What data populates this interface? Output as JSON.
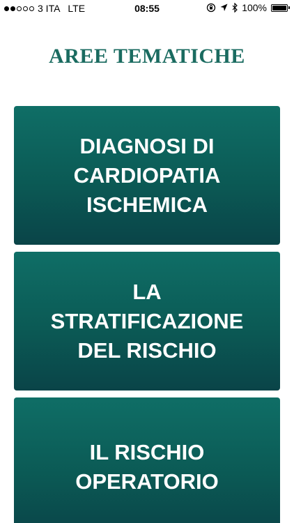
{
  "status_bar": {
    "carrier": "3 ITA",
    "network": "LTE",
    "time": "08:55",
    "battery": "100%",
    "battery_level": 1.0,
    "signal_bars_filled": 2,
    "signal_bars_total": 5
  },
  "header": {
    "title": "AREE TEMATICHE"
  },
  "topics": [
    {
      "label": "DIAGNOSI DI\nCARDIOPATIA\nISCHEMICA"
    },
    {
      "label": "LA\nSTRATIFICAZIONE\nDEL RISCHIO"
    },
    {
      "label": "IL RISCHIO\nOPERATORIO"
    }
  ],
  "colors": {
    "accent": "#1a6b60",
    "card_top": "#0f6e66",
    "card_bottom": "#0a4448",
    "card_text": "#ffffff"
  }
}
